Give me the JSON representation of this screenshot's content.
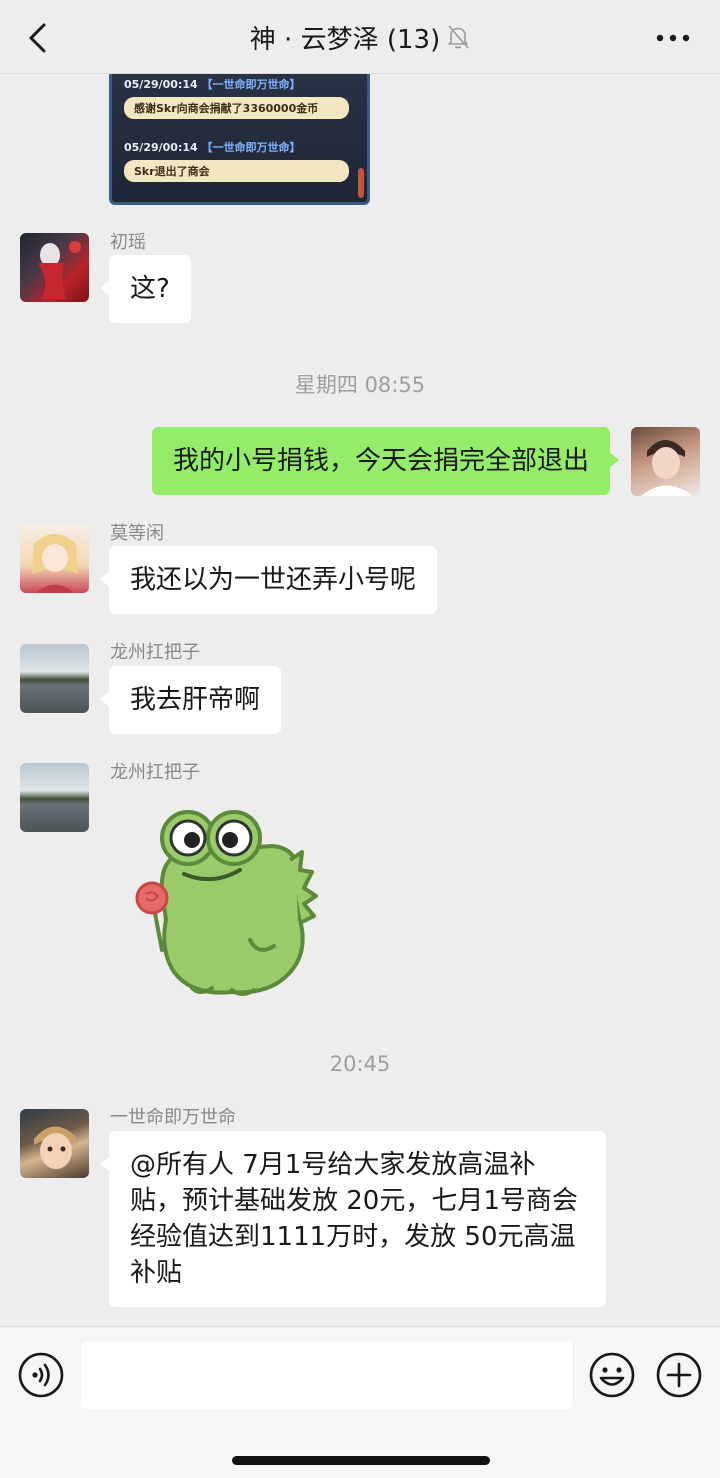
{
  "header": {
    "title": "神 · 云梦泽 (13)",
    "back_icon": "chevron-left-icon",
    "muted_icon": "bell-off-icon",
    "more_icon": "ellipsis-icon"
  },
  "game_screenshot": {
    "entries": [
      {
        "time": "05/29/00:14",
        "tag": "【一世命即万世命】",
        "text": "感谢Skr向商会捐献了3360000金币"
      },
      {
        "time": "05/29/00:14",
        "tag": "【一世命即万世命】",
        "text": "Skr退出了商会"
      }
    ]
  },
  "messages": [
    {
      "sender": "初瑶",
      "text": "这?"
    },
    {
      "timestamp": "星期四 08:55"
    },
    {
      "outgoing": true,
      "text": "我的小号捐钱，今天会捐完全部退出"
    },
    {
      "sender": "莫等闲",
      "text": "我还以为一世还弄小号呢"
    },
    {
      "sender": "龙州扛把子",
      "text": "我去肝帝啊"
    },
    {
      "sender": "龙州扛把子",
      "sticker": "frog-lollipop-sticker"
    },
    {
      "timestamp": "20:45"
    },
    {
      "sender": "一世命即万世命",
      "text": "@所有人 7月1号给大家发放高温补贴，预计基础发放 20元，七月1号商会经验值达到1111万时，发放 50元高温补贴"
    }
  ],
  "input_bar": {
    "voice_icon": "voice-icon",
    "emoji_icon": "emoji-icon",
    "plus_icon": "plus-icon",
    "placeholder": ""
  },
  "colors": {
    "background": "#ededed",
    "incoming_bubble": "#ffffff",
    "outgoing_bubble": "#95ec69",
    "game_tag": "#7eb1ff"
  }
}
